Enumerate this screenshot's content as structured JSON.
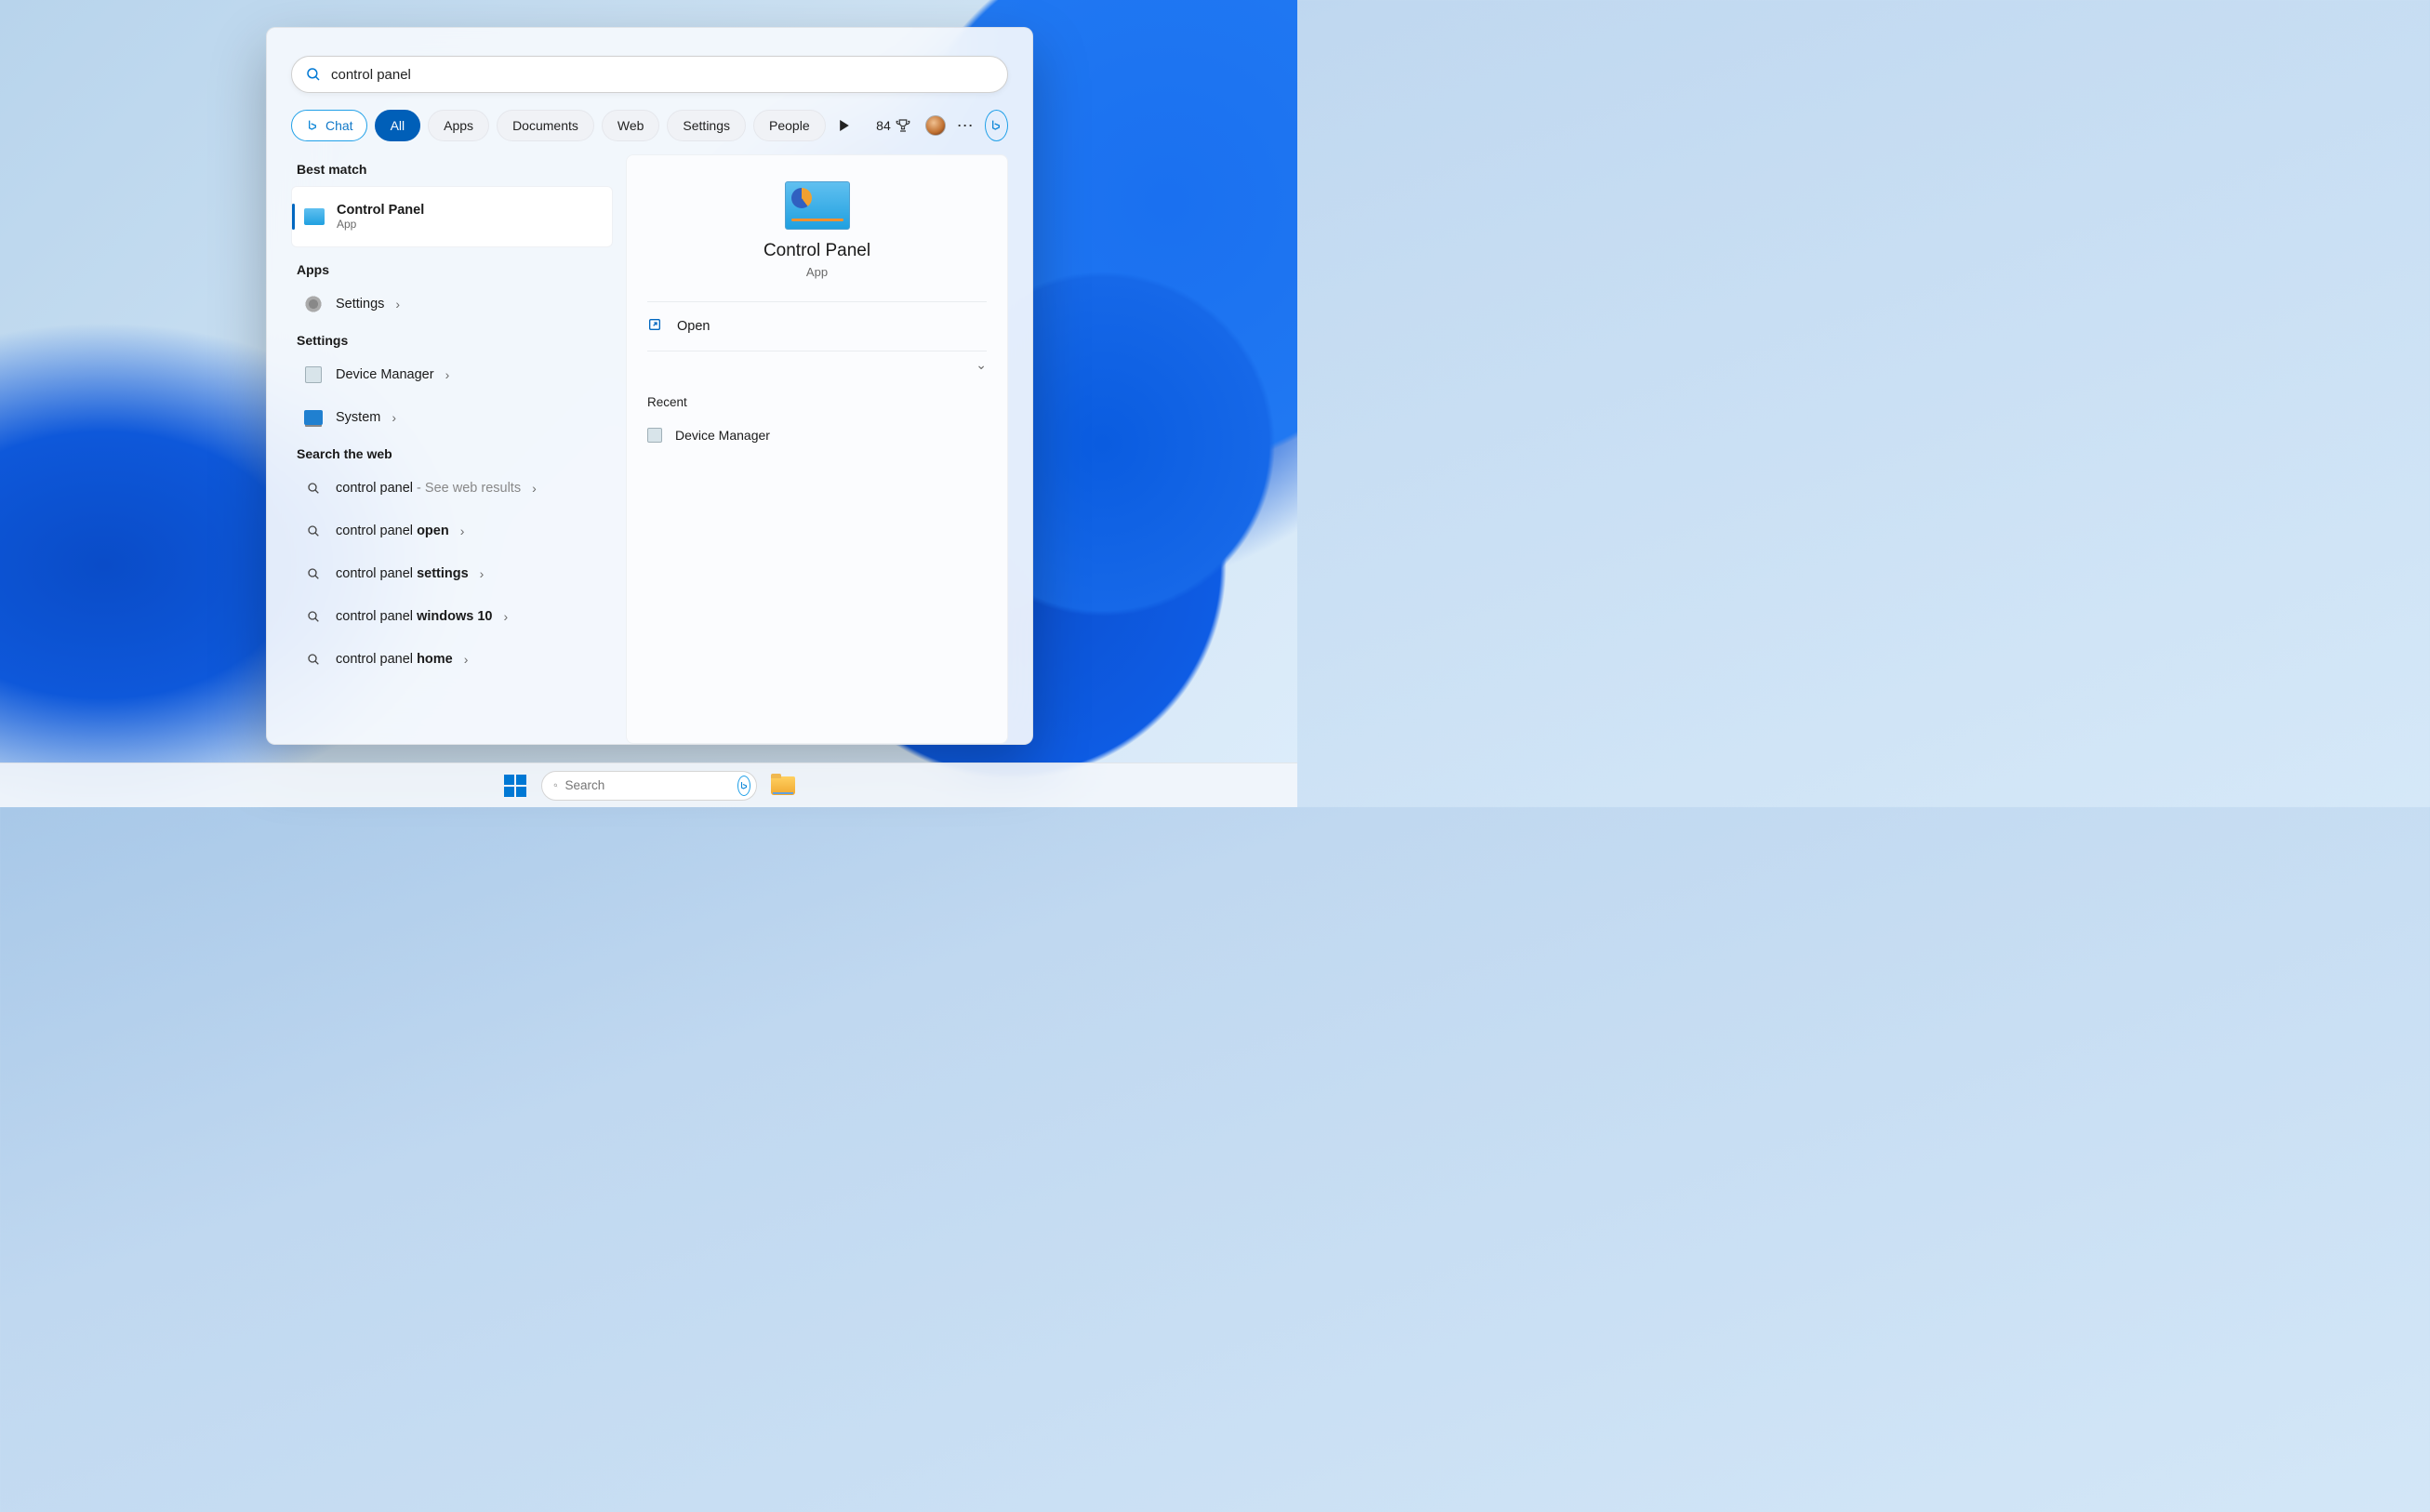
{
  "search": {
    "query": "control panel",
    "placeholder": ""
  },
  "filters": {
    "chat": "Chat",
    "all": "All",
    "apps": "Apps",
    "documents": "Documents",
    "web": "Web",
    "settings": "Settings",
    "people": "People"
  },
  "rewards": {
    "points": "84"
  },
  "more": "⋯",
  "sections": {
    "best_match": "Best match",
    "apps": "Apps",
    "settings": "Settings",
    "search_web": "Search the web"
  },
  "results": {
    "best": {
      "title": "Control Panel",
      "sub": "App"
    },
    "apps": [
      {
        "title": "Settings"
      }
    ],
    "settings": [
      {
        "title": "Device Manager"
      },
      {
        "title": "System"
      }
    ],
    "web": [
      {
        "prefix": "control panel",
        "suffix": "",
        "hint": " - See web results"
      },
      {
        "prefix": "control panel ",
        "suffix": "open",
        "hint": ""
      },
      {
        "prefix": "control panel ",
        "suffix": "settings",
        "hint": ""
      },
      {
        "prefix": "control panel ",
        "suffix": "windows 10",
        "hint": ""
      },
      {
        "prefix": "control panel ",
        "suffix": "home",
        "hint": ""
      }
    ]
  },
  "preview": {
    "title": "Control Panel",
    "sub": "App",
    "open": "Open",
    "recent_header": "Recent",
    "recent": [
      {
        "title": "Device Manager"
      }
    ]
  },
  "taskbar": {
    "search_placeholder": "Search"
  }
}
